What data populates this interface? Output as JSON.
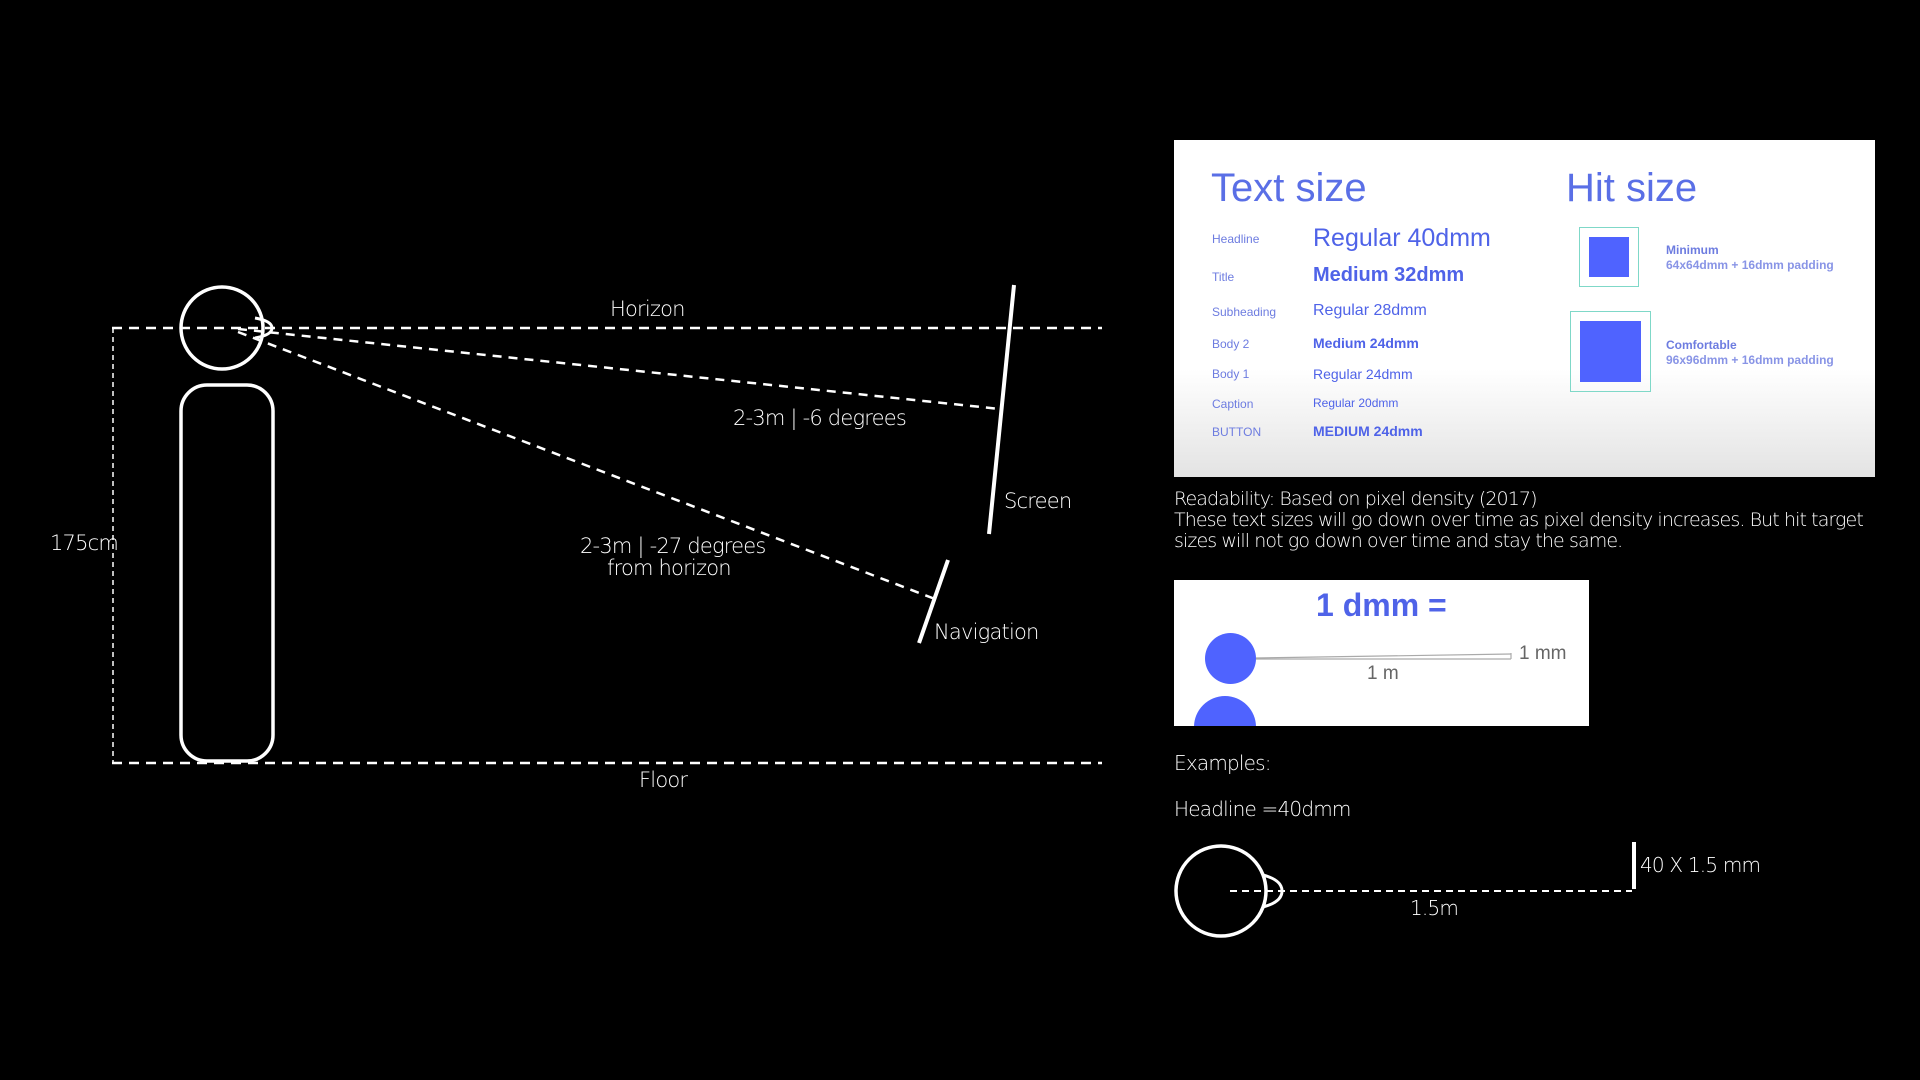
{
  "diagram": {
    "horizon_label": "Horizon",
    "floor_label": "Floor",
    "height_label": "175cm",
    "screen_label": "Screen",
    "navigation_label": "Navigation",
    "screen_angle_label": "2-3m | -6 degrees",
    "nav_angle_label_line1": "2-3m | -27 degrees",
    "nav_angle_label_line2": "from horizon"
  },
  "text_size_card": {
    "heading": "Text size",
    "rows": [
      {
        "name": "Headline",
        "value": "Regular 40dmm"
      },
      {
        "name": "Title",
        "value": "Medium 32dmm"
      },
      {
        "name": "Subheading",
        "value": "Regular 28dmm"
      },
      {
        "name": "Body 2",
        "value": "Medium 24dmm"
      },
      {
        "name": "Body 1",
        "value": "Regular 24dmm"
      },
      {
        "name": "Caption",
        "value": "Regular 20dmm"
      },
      {
        "name": "BUTTON",
        "value": "MEDIUM 24dmm"
      }
    ],
    "hit_heading": "Hit size",
    "hit_items": [
      {
        "title": "Minimum",
        "desc": "64x64dmm + 16dmm padding"
      },
      {
        "title": "Comfortable",
        "desc": "96x96dmm + 16dmm padding"
      }
    ]
  },
  "readability": {
    "line1": "Readability: Based on pixel density (2017)",
    "line2": "These text sizes will go down over time as pixel density increases. But hit target sizes will not go down over time and stay the same."
  },
  "dmm_card": {
    "title": "1 dmm =",
    "distance_label": "1 m",
    "size_label": "1 mm"
  },
  "examples": {
    "heading": "Examples:",
    "headline_example": "Headline =40dmm",
    "distance_label": "1.5m",
    "size_label": "40 X 1.5 mm"
  },
  "colors": {
    "background": "#000000",
    "accent_blue": "#4f63ff",
    "hit_border": "#7fd8c8"
  }
}
